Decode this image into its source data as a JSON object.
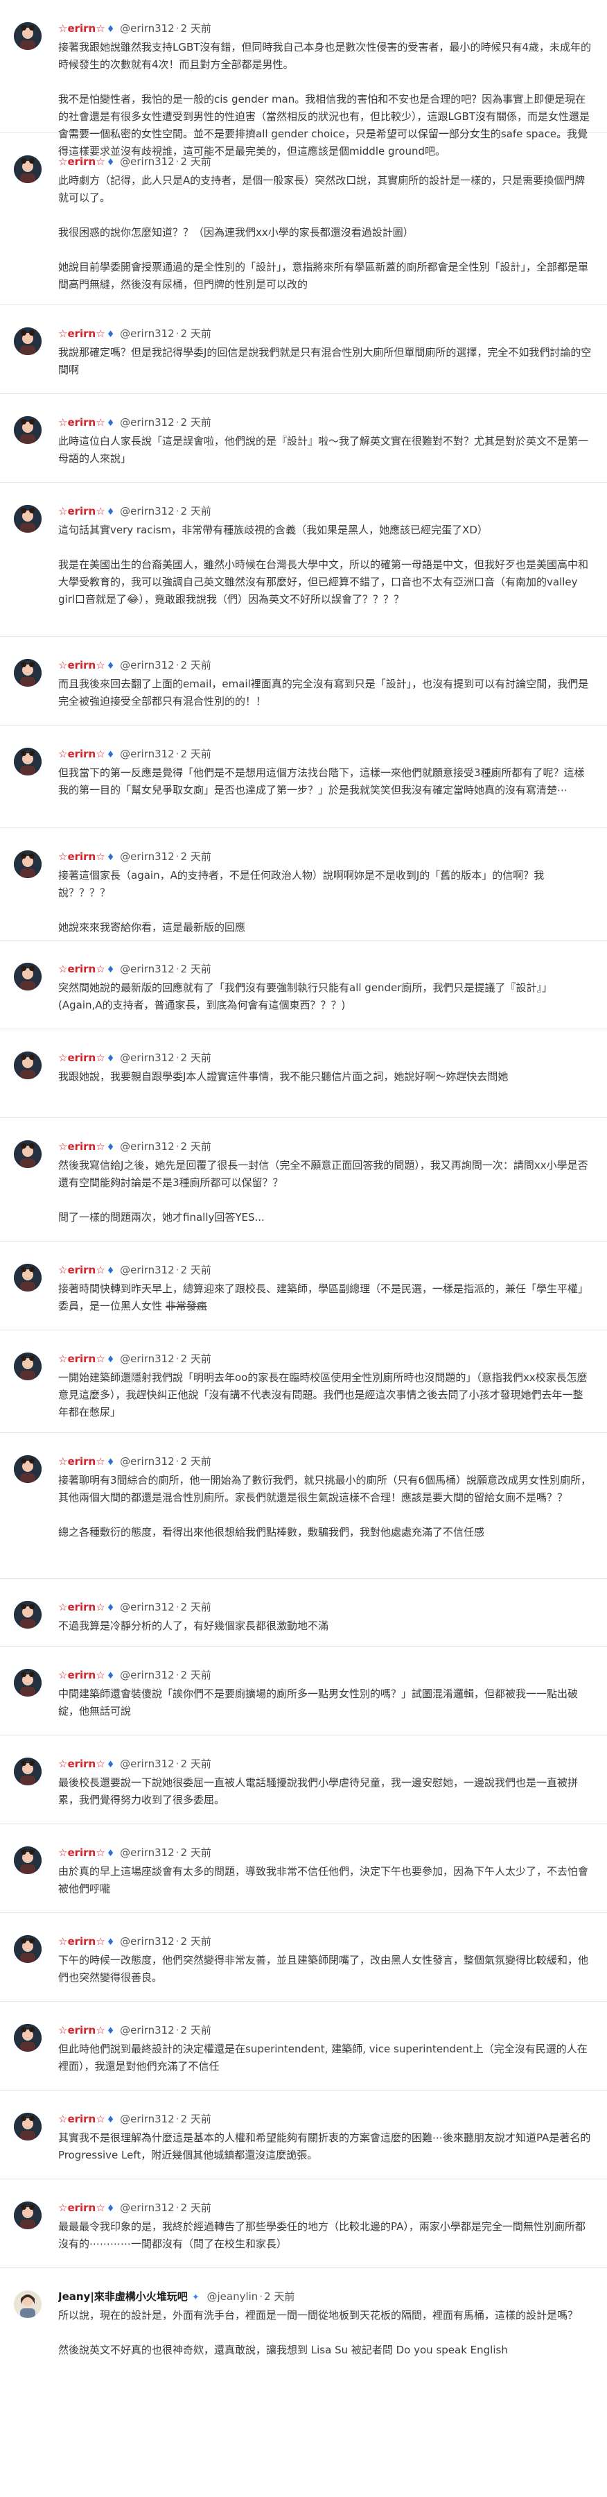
{
  "thread": {
    "posts": [
      {
        "author": "☆erirn☆",
        "handle": "@erirn312",
        "time": "2 天前",
        "paragraphs": [
          "接著我跟她說雖然我支持LGBT沒有錯，但同時我自己本身也是數次性侵害的受害者，最小的時候只有4歲，未成年的時候發生的次數就有4次！而且對方全部都是男性。",
          "我不是怕變性者，我怕的是一般的cis gender man。我相信我的害怕和不安也是合理的吧？因為事實上即便是現在的社會還是有很多女性遭受到男性的性迫害（當然相反的狀況也有，但比較少），這跟LGBT沒有關係，而是女性還是會需要一個私密的女性空間。並不是要排擠all gender choice，只是希望可以保留一部分女生的safe space。我覺得這樣要求並沒有歧視誰，這可能不是最完美的，但這應該是個middle ground吧。"
        ],
        "strike_tail": ""
      },
      {
        "author": "☆erirn☆",
        "handle": "@erirn312",
        "time": "2 天前",
        "paragraphs": [
          "此時劇方（記得，此人只是A的支持者，是個一般家長）突然改口說，其實廁所的設計是一樣的，只是需要換個門牌就可以了。",
          "我很困惑的說你怎麼知道？？（因為連我們xx小學的家長都還沒看過設計圖）",
          "她說目前學委開會授票通過的是全性別的「設計」，意指將來所有學區新蓋的廁所都會是全性別「設計」，全部都是單間高門無縫，然後沒有尿桶，但門牌的性別是可以改的"
        ],
        "strike_tail": ""
      },
      {
        "author": "☆erirn☆",
        "handle": "@erirn312",
        "time": "2 天前",
        "paragraphs": [
          "我說那確定嗎？但是我記得學委J的回信是說我們就是只有混合性別大廁所但單間廁所的選擇，完全不如我們討論的空間啊"
        ],
        "strike_tail": ""
      },
      {
        "author": "☆erirn☆",
        "handle": "@erirn312",
        "time": "2 天前",
        "paragraphs": [
          "此時這位白人家長說「這是誤會啦，他們說的是『設計』啦～我了解英文實在很難對不對？尤其是對於英文不是第一母語的人來說」"
        ],
        "strike_tail": ""
      },
      {
        "author": "☆erirn☆",
        "handle": "@erirn312",
        "time": "2 天前",
        "paragraphs": [
          "這句話其實very racism，非常帶有種族歧視的含義（我如果是黑人，她應該已經完蛋了XD）",
          "我是在美國出生的台裔美國人，雖然小時候在台灣長大學中文，所以的確第一母語是中文，但我好歹也是美國高中和大學受教育的，我可以強調自己英文雖然沒有那麼好，但已經算不錯了，口音也不太有亞洲口音（有南加的valley girl口音就是了😂），竟敢跟我說我（們）因為英文不好所以誤會了？？？？"
        ],
        "strike_tail": ""
      },
      {
        "author": "☆erirn☆",
        "handle": "@erirn312",
        "time": "2 天前",
        "paragraphs": [
          "而且我後來回去翻了上面的email，email裡面真的完全沒有寫到只是「設計」，也沒有提到可以有討論空間，我們是完全被強迫接受全部都只有混合性別的的！！"
        ],
        "strike_tail": ""
      },
      {
        "author": "☆erirn☆",
        "handle": "@erirn312",
        "time": "2 天前",
        "paragraphs": [
          "但我當下的第一反應是覺得「他們是不是想用這個方法找台階下，這樣一來他們就願意接受3種廁所都有了呢？這樣我的第一目的「幫女兒爭取女廁」是否也達成了第一步？」於是我就笑笑但我沒有確定當時她真的沒有寫清楚⋯"
        ],
        "strike_tail": ""
      },
      {
        "author": "☆erirn☆",
        "handle": "@erirn312",
        "time": "2 天前",
        "paragraphs": [
          "接著這個家長（again，A的支持者，不是任何政治人物）說啊啊妳是不是收到J的「舊的版本」的信啊？我說？？？？",
          "她說來來我寄給你看，這是最新版的回應"
        ],
        "strike_tail": ""
      },
      {
        "author": "☆erirn☆",
        "handle": "@erirn312",
        "time": "2 天前",
        "paragraphs": [
          "突然間她說的最新版的回應就有了「我們沒有要強制執行只能有all gender廁所，我們只是提議了『設計』」(Again,A的支持者，普通家長，到底為何會有這個東西？？？)"
        ],
        "strike_tail": ""
      },
      {
        "author": "☆erirn☆",
        "handle": "@erirn312",
        "time": "2 天前",
        "paragraphs": [
          "我跟她說，我要親自跟學委J本人證實這件事情，我不能只聽信片面之詞，她說好啊～妳趕快去問她"
        ],
        "strike_tail": ""
      },
      {
        "author": "☆erirn☆",
        "handle": "@erirn312",
        "time": "2 天前",
        "paragraphs": [
          "然後我寫信給J之後，她先是回覆了很長一封信（完全不願意正面回答我的問題），我又再詢問一次：請問xx小學是否還有空間能夠討論是不是3種廁所都可以保留？？",
          "問了一樣的問題兩次，她才finally回答YES..."
        ],
        "strike_tail": ""
      },
      {
        "author": "☆erirn☆",
        "handle": "@erirn312",
        "time": "2 天前",
        "paragraphs": [
          "接著時間快轉到昨天早上，總算迎來了跟校長、建築師，學區副總理（不是民選，一樣是指派的，兼任「學生平權」委員，是一位黑人女性"
        ],
        "strike_tail": "非常發瘋"
      },
      {
        "author": "☆erirn☆",
        "handle": "@erirn312",
        "time": "2 天前",
        "paragraphs": [
          "一開始建築師還隱射我們說「明明去年oo的家長在臨時校區使用全性別廁所時也沒問題的」（意指我們xx校家長怎麼意見這麼多），我趕快糾正他說「沒有講不代表沒有問題。我們也是經這次事情之後去問了小孩才發現她們去年一整年都在憋尿」"
        ],
        "strike_tail": ""
      },
      {
        "author": "☆erirn☆",
        "handle": "@erirn312",
        "time": "2 天前",
        "paragraphs": [
          "接著聊明有3間綜合的廁所，他一開始為了數衍我們，就只挑最小的廁所（只有6個馬桶）說願意改成男女性別廁所，其他兩個大間的都還是混合性別廁所。家長們就還是很生氣說這樣不合理！應該是要大間的留給女廁不是嗎？？",
          "總之各種敷衍的態度，看得出來他很想給我們點棒數，敷騙我們，我對他處處充滿了不信任感"
        ],
        "strike_tail": ""
      },
      {
        "author": "☆erirn☆",
        "handle": "@erirn312",
        "time": "2 天前",
        "paragraphs": [
          "不過我算是冷靜分析的人了，有好幾個家長都很激動地不滿"
        ],
        "strike_tail": ""
      },
      {
        "author": "☆erirn☆",
        "handle": "@erirn312",
        "time": "2 天前",
        "paragraphs": [
          "中間建築師還會裝傻說「誒你們不是要廁擴場的廁所多一點男女性別的嗎？」試圖混淆邏輯，但都被我一一點出破綻，他無話可說"
        ],
        "strike_tail": ""
      },
      {
        "author": "☆erirn☆",
        "handle": "@erirn312",
        "time": "2 天前",
        "paragraphs": [
          "最後校長還要說一下說她很委屈一直被人電話騷擾說我們小學虐待兒童，我一邊安慰她，一邊說我們也是一直被拼累，我們覺得努力收到了很多委屈。"
        ],
        "strike_tail": ""
      },
      {
        "author": "☆erirn☆",
        "handle": "@erirn312",
        "time": "2 天前",
        "paragraphs": [
          "由於真的早上這場座談會有太多的問題，導致我非常不信任他們，決定下午也要參加，因為下午人太少了，不去怕會被他們呼嚨"
        ],
        "strike_tail": ""
      },
      {
        "author": "☆erirn☆",
        "handle": "@erirn312",
        "time": "2 天前",
        "paragraphs": [
          "下午的時候一改態度，他們突然變得非常友善，並且建築師閉嘴了，改由黑人女性發言，整個氣氛變得比較緩和，他們也突然變得很善良。"
        ],
        "strike_tail": ""
      },
      {
        "author": "☆erirn☆",
        "handle": "@erirn312",
        "time": "2 天前",
        "paragraphs": [
          "但此時他們說到最終設計的決定權還是在superintendent, 建築師, vice superintendent上（完全沒有民選的人在裡面），我還是對他們充滿了不信任"
        ],
        "strike_tail": ""
      },
      {
        "author": "☆erirn☆",
        "handle": "@erirn312",
        "time": "2 天前",
        "paragraphs": [
          "其實我不是很理解為什麼這是基本的人權和希望能夠有關折衷的方案會這麼的困難⋯後來聽朋友說才知道PA是著名的Progressive Left，附近幾個其他城鎮都還沒這麼詭張。"
        ],
        "strike_tail": ""
      },
      {
        "author": "☆erirn☆",
        "handle": "@erirn312",
        "time": "2 天前",
        "paragraphs": [
          "最最最令我印象的是，我終於經過轉告了那些學委任的地方（比較北邊的PA），兩家小學都是完全一間無性別廁所都沒有的⋯⋯⋯⋯一間都沒有（問了在校生和家長）"
        ],
        "strike_tail": ""
      },
      {
        "author": "Jeany|來非虛構小火堆玩吧",
        "handle": "@jeanylin",
        "time": "2 天前",
        "paragraphs": [
          "所以說，現在的設計是，外面有洗手台，裡面是一間一間從地板到天花板的隔間，裡面有馬桶，這樣的設計是嗎？",
          "然後說英文不好真的也很神奇欸，還真敢說，讓我想到 Lisa Su 被記者問 Do you speak English"
        ],
        "strike_tail": ""
      }
    ]
  }
}
